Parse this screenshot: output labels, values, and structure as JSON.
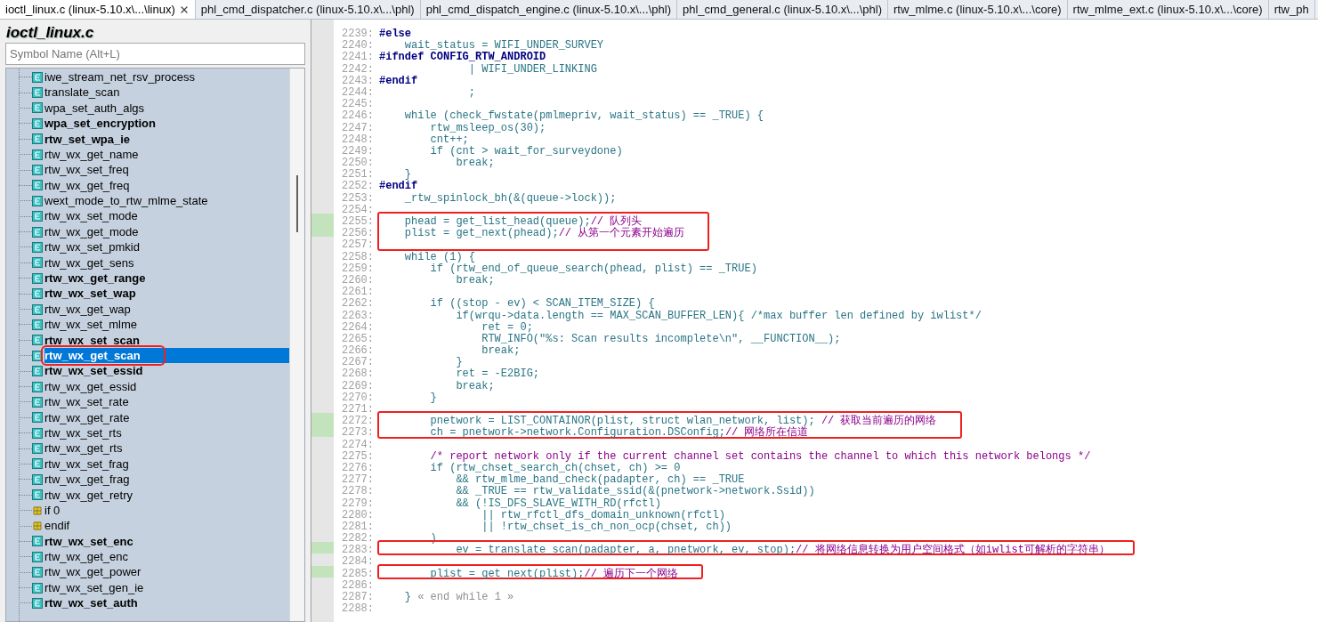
{
  "tabs": [
    {
      "label": "ioctl_linux.c (linux-5.10.x\\...\\linux)",
      "selected": true
    },
    {
      "label": "phl_cmd_dispatcher.c (linux-5.10.x\\...\\phl)",
      "selected": false
    },
    {
      "label": "phl_cmd_dispatch_engine.c (linux-5.10.x\\...\\phl)",
      "selected": false
    },
    {
      "label": "phl_cmd_general.c (linux-5.10.x\\...\\phl)",
      "selected": false
    },
    {
      "label": "rtw_mlme.c (linux-5.10.x\\...\\core)",
      "selected": false
    },
    {
      "label": "rtw_mlme_ext.c (linux-5.10.x\\...\\core)",
      "selected": false
    },
    {
      "label": "rtw_ph",
      "selected": false
    }
  ],
  "sidebar": {
    "title": "ioctl_linux.c",
    "search": {
      "placeholder": "Symbol Name (Alt+L)"
    },
    "items": [
      {
        "label": "iwe_stream_net_rsv_process",
        "kind": "function",
        "bold": false,
        "selected": false,
        "boxed": false
      },
      {
        "label": "translate_scan",
        "kind": "function",
        "bold": false,
        "selected": false,
        "boxed": false
      },
      {
        "label": "wpa_set_auth_algs",
        "kind": "function",
        "bold": false,
        "selected": false,
        "boxed": false
      },
      {
        "label": "wpa_set_encryption",
        "kind": "function",
        "bold": true,
        "selected": false,
        "boxed": false
      },
      {
        "label": "rtw_set_wpa_ie",
        "kind": "function",
        "bold": true,
        "selected": false,
        "boxed": false
      },
      {
        "label": "rtw_wx_get_name",
        "kind": "function",
        "bold": false,
        "selected": false,
        "boxed": false
      },
      {
        "label": "rtw_wx_set_freq",
        "kind": "function",
        "bold": false,
        "selected": false,
        "boxed": false
      },
      {
        "label": "rtw_wx_get_freq",
        "kind": "function",
        "bold": false,
        "selected": false,
        "boxed": false
      },
      {
        "label": "wext_mode_to_rtw_mlme_state",
        "kind": "function",
        "bold": false,
        "selected": false,
        "boxed": false
      },
      {
        "label": "rtw_wx_set_mode",
        "kind": "function",
        "bold": false,
        "selected": false,
        "boxed": false
      },
      {
        "label": "rtw_wx_get_mode",
        "kind": "function",
        "bold": false,
        "selected": false,
        "boxed": false
      },
      {
        "label": "rtw_wx_set_pmkid",
        "kind": "function",
        "bold": false,
        "selected": false,
        "boxed": false
      },
      {
        "label": "rtw_wx_get_sens",
        "kind": "function",
        "bold": false,
        "selected": false,
        "boxed": false
      },
      {
        "label": "rtw_wx_get_range",
        "kind": "function",
        "bold": true,
        "selected": false,
        "boxed": false
      },
      {
        "label": "rtw_wx_set_wap",
        "kind": "function",
        "bold": true,
        "selected": false,
        "boxed": false
      },
      {
        "label": "rtw_wx_get_wap",
        "kind": "function",
        "bold": false,
        "selected": false,
        "boxed": false
      },
      {
        "label": "rtw_wx_set_mlme",
        "kind": "function",
        "bold": false,
        "selected": false,
        "boxed": false
      },
      {
        "label": "rtw_wx_set_scan",
        "kind": "function",
        "bold": true,
        "selected": false,
        "boxed": false
      },
      {
        "label": "rtw_wx_get_scan",
        "kind": "function",
        "bold": true,
        "selected": true,
        "boxed": true
      },
      {
        "label": "rtw_wx_set_essid",
        "kind": "function",
        "bold": true,
        "selected": false,
        "boxed": false
      },
      {
        "label": "rtw_wx_get_essid",
        "kind": "function",
        "bold": false,
        "selected": false,
        "boxed": false
      },
      {
        "label": "rtw_wx_set_rate",
        "kind": "function",
        "bold": false,
        "selected": false,
        "boxed": false
      },
      {
        "label": "rtw_wx_get_rate",
        "kind": "function",
        "bold": false,
        "selected": false,
        "boxed": false
      },
      {
        "label": "rtw_wx_set_rts",
        "kind": "function",
        "bold": false,
        "selected": false,
        "boxed": false
      },
      {
        "label": "rtw_wx_get_rts",
        "kind": "function",
        "bold": false,
        "selected": false,
        "boxed": false
      },
      {
        "label": "rtw_wx_set_frag",
        "kind": "function",
        "bold": false,
        "selected": false,
        "boxed": false
      },
      {
        "label": "rtw_wx_get_frag",
        "kind": "function",
        "bold": false,
        "selected": false,
        "boxed": false
      },
      {
        "label": "rtw_wx_get_retry",
        "kind": "function",
        "bold": false,
        "selected": false,
        "boxed": false
      },
      {
        "label": "if 0",
        "kind": "directive",
        "bold": false,
        "selected": false,
        "boxed": false
      },
      {
        "label": "endif",
        "kind": "directive",
        "bold": false,
        "selected": false,
        "boxed": false
      },
      {
        "label": "rtw_wx_set_enc",
        "kind": "function",
        "bold": true,
        "selected": false,
        "boxed": false
      },
      {
        "label": "rtw_wx_get_enc",
        "kind": "function",
        "bold": false,
        "selected": false,
        "boxed": false
      },
      {
        "label": "rtw_wx_get_power",
        "kind": "function",
        "bold": false,
        "selected": false,
        "boxed": false
      },
      {
        "label": "rtw_wx_set_gen_ie",
        "kind": "function",
        "bold": false,
        "selected": false,
        "boxed": false
      },
      {
        "label": "rtw_wx_set_auth",
        "kind": "function",
        "bold": true,
        "selected": false,
        "boxed": false
      }
    ]
  },
  "code": {
    "lines": [
      {
        "number": "2239:",
        "kind": "directive",
        "text": "#else",
        "changed": false,
        "boxed": false
      },
      {
        "number": "2240:",
        "kind": "code",
        "text": "    wait_status = WIFI_UNDER_SURVEY",
        "changed": false,
        "boxed": false
      },
      {
        "number": "2241:",
        "kind": "directive",
        "text": "#ifndef CONFIG_RTW_ANDROID",
        "changed": false,
        "boxed": false
      },
      {
        "number": "2242:",
        "kind": "code",
        "text": "              | WIFI_UNDER_LINKING",
        "changed": false,
        "boxed": false
      },
      {
        "number": "2243:",
        "kind": "directive",
        "text": "#endif",
        "changed": false,
        "boxed": false
      },
      {
        "number": "2244:",
        "kind": "code",
        "text": "              ;",
        "changed": false,
        "boxed": false
      },
      {
        "number": "2245:",
        "changed": false,
        "boxed": false
      },
      {
        "number": "2246:",
        "kind": "code",
        "text": "    while (check_fwstate(pmlmepriv, wait_status) == _TRUE) {",
        "changed": false,
        "boxed": false
      },
      {
        "number": "2247:",
        "kind": "code",
        "text": "        rtw_msleep_os(30);",
        "changed": false,
        "boxed": false
      },
      {
        "number": "2248:",
        "kind": "code",
        "text": "        cnt++;",
        "changed": false,
        "boxed": false
      },
      {
        "number": "2249:",
        "kind": "code",
        "text": "        if (cnt > wait_for_surveydone)",
        "changed": false,
        "boxed": false
      },
      {
        "number": "2250:",
        "kind": "code",
        "text": "            break;",
        "changed": false,
        "boxed": false
      },
      {
        "number": "2251:",
        "kind": "code",
        "text": "    }",
        "changed": false,
        "boxed": false
      },
      {
        "number": "2252:",
        "kind": "directive",
        "text": "#endif",
        "changed": false,
        "boxed": false
      },
      {
        "number": "2253:",
        "kind": "code",
        "text": "    _rtw_spinlock_bh(&(queue->lock));",
        "changed": false,
        "boxed": false
      },
      {
        "number": "2254:",
        "changed": false,
        "boxed": false
      },
      {
        "number": "2255:",
        "kind": "code",
        "text": "    phead = get_list_head(queue);",
        "note": {
          "text": "// 队列头",
          "kind": "comment"
        },
        "changed": true,
        "boxed": true
      },
      {
        "number": "2256:",
        "kind": "code",
        "text": "    plist = get_next(phead);",
        "note": {
          "text": "// 从第一个元素开始遍历",
          "kind": "comment"
        },
        "changed": true,
        "boxed": true
      },
      {
        "number": "2257:",
        "changed": false,
        "boxed": true
      },
      {
        "number": "2258:",
        "kind": "code",
        "text": "    while (1) {",
        "changed": false,
        "boxed": false
      },
      {
        "number": "2259:",
        "kind": "code",
        "text": "        if (rtw_end_of_queue_search(phead, plist) == _TRUE)",
        "changed": false,
        "boxed": false
      },
      {
        "number": "2260:",
        "kind": "code",
        "text": "            break;",
        "changed": false,
        "boxed": false
      },
      {
        "number": "2261:",
        "changed": false,
        "boxed": false
      },
      {
        "number": "2262:",
        "kind": "code",
        "text": "        if ((stop - ev) < SCAN_ITEM_SIZE) {",
        "changed": false,
        "boxed": false
      },
      {
        "number": "2263:",
        "kind": "code",
        "text": "            if(wrqu->data.length == MAX_SCAN_BUFFER_LEN){ /*max buffer len defined by iwlist*/",
        "changed": false,
        "boxed": false
      },
      {
        "number": "2264:",
        "kind": "code",
        "text": "                ret = 0;",
        "changed": false,
        "boxed": false
      },
      {
        "number": "2265:",
        "kind": "code",
        "text": "                RTW_INFO(\"%s: Scan results incomplete\\n\", __FUNCTION__);",
        "changed": false,
        "boxed": false
      },
      {
        "number": "2266:",
        "kind": "code",
        "text": "                break;",
        "changed": false,
        "boxed": false
      },
      {
        "number": "2267:",
        "kind": "code",
        "text": "            }",
        "changed": false,
        "boxed": false
      },
      {
        "number": "2268:",
        "kind": "code",
        "text": "            ret = -E2BIG;",
        "changed": false,
        "boxed": false
      },
      {
        "number": "2269:",
        "kind": "code",
        "text": "            break;",
        "changed": false,
        "boxed": false
      },
      {
        "number": "2270:",
        "kind": "code",
        "text": "        }",
        "changed": false,
        "boxed": false
      },
      {
        "number": "2271:",
        "changed": false,
        "boxed": false
      },
      {
        "number": "2272:",
        "kind": "code",
        "text": "        pnetwork = LIST_CONTAINOR(plist, struct wlan_network, list); ",
        "note": {
          "text": "// 获取当前遍历的网络",
          "kind": "comment"
        },
        "changed": true,
        "boxed": true
      },
      {
        "number": "2273:",
        "kind": "code",
        "text": "        ch = pnetwork->network.Configuration.DSConfig;",
        "note": {
          "text": "// 网络所在信道",
          "kind": "comment"
        },
        "changed": true,
        "boxed": true
      },
      {
        "number": "2274:",
        "changed": false,
        "boxed": false
      },
      {
        "number": "2275:",
        "kind": "comment",
        "text": "        /* report network only if the current channel set contains the channel to which this network belongs */",
        "changed": false,
        "boxed": false
      },
      {
        "number": "2276:",
        "kind": "code",
        "text": "        if (rtw_chset_search_ch(chset, ch) >= 0",
        "changed": false,
        "boxed": false
      },
      {
        "number": "2277:",
        "kind": "code",
        "text": "            && rtw_mlme_band_check(padapter, ch) == _TRUE",
        "changed": false,
        "boxed": false
      },
      {
        "number": "2278:",
        "kind": "code",
        "text": "            && _TRUE == rtw_validate_ssid(&(pnetwork->network.Ssid))",
        "changed": false,
        "boxed": false
      },
      {
        "number": "2279:",
        "kind": "code",
        "text": "            && (!IS_DFS_SLAVE_WITH_RD(rfctl)",
        "changed": false,
        "boxed": false
      },
      {
        "number": "2280:",
        "kind": "code",
        "text": "                || rtw_rfctl_dfs_domain_unknown(rfctl)",
        "changed": false,
        "boxed": false
      },
      {
        "number": "2281:",
        "kind": "code",
        "text": "                || !rtw_chset_is_ch_non_ocp(chset, ch))",
        "changed": false,
        "boxed": false
      },
      {
        "number": "2282:",
        "kind": "code",
        "text": "        )",
        "changed": false,
        "boxed": false
      },
      {
        "number": "2283:",
        "kind": "code",
        "text": "            ev = translate_scan(padapter, a, pnetwork, ev, stop);",
        "note": {
          "text": "// 将网络信息转换为用户空间格式（如iwlist可解析的字符串）",
          "kind": "comment"
        },
        "changed": true,
        "boxed": true
      },
      {
        "number": "2284:",
        "changed": false,
        "boxed": false
      },
      {
        "number": "2285:",
        "kind": "code",
        "text": "        plist = get_next(plist);",
        "note": {
          "text": "// 遍历下一个网络",
          "kind": "comment"
        },
        "changed": true,
        "boxed": true
      },
      {
        "number": "2286:",
        "changed": false,
        "boxed": false
      },
      {
        "number": "2287:",
        "kind": "code",
        "text": "    } ",
        "note": {
          "text": "« end while 1 »",
          "kind": "fold"
        },
        "changed": false,
        "boxed": false
      },
      {
        "number": "2288:",
        "changed": false,
        "boxed": false
      }
    ]
  }
}
